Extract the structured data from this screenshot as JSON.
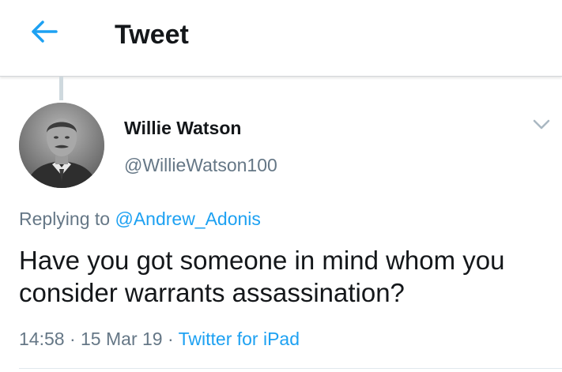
{
  "header": {
    "back_icon": "arrow-left-icon",
    "title": "Tweet",
    "accent_color": "#1da1f2"
  },
  "tweet": {
    "author": {
      "name": "Willie Watson",
      "handle": "@WillieWatson100",
      "avatar": "vintage-portrait-photo"
    },
    "menu_icon": "chevron-down-icon",
    "replying_prefix": "Replying to",
    "replying_to": "@Andrew_Adonis",
    "text": "Have you got someone in mind whom you consider warrants assassination?",
    "time": "14:58",
    "date": "15 Mar 19",
    "separator": "·",
    "source": "Twitter for iPad"
  }
}
